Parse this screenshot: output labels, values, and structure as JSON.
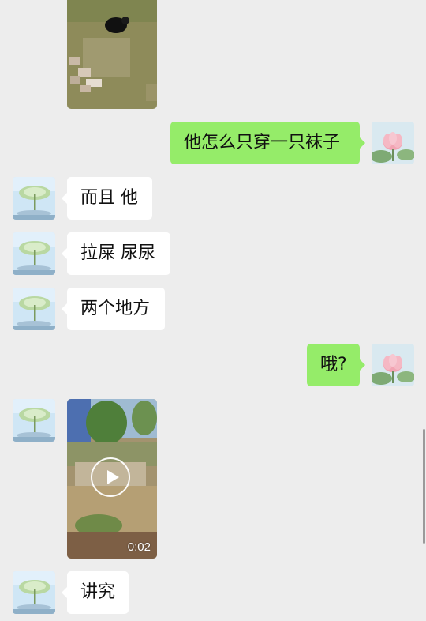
{
  "messages": {
    "m1": {
      "text": "他怎么只穿一只袜子"
    },
    "m2": {
      "text": "而且 他"
    },
    "m3": {
      "text": "拉屎 尿尿"
    },
    "m4": {
      "text": "两个地方"
    },
    "m5": {
      "text": "哦?"
    },
    "m7": {
      "text": "讲究"
    }
  },
  "video": {
    "duration": "0:02"
  },
  "colors": {
    "background": "#ededed",
    "sent_bubble": "#95ec69",
    "received_bubble": "#ffffff"
  },
  "icons": {
    "play": "play-icon",
    "contact_avatar": "lotus-leaf-avatar",
    "self_avatar": "pink-lotus-avatar"
  }
}
